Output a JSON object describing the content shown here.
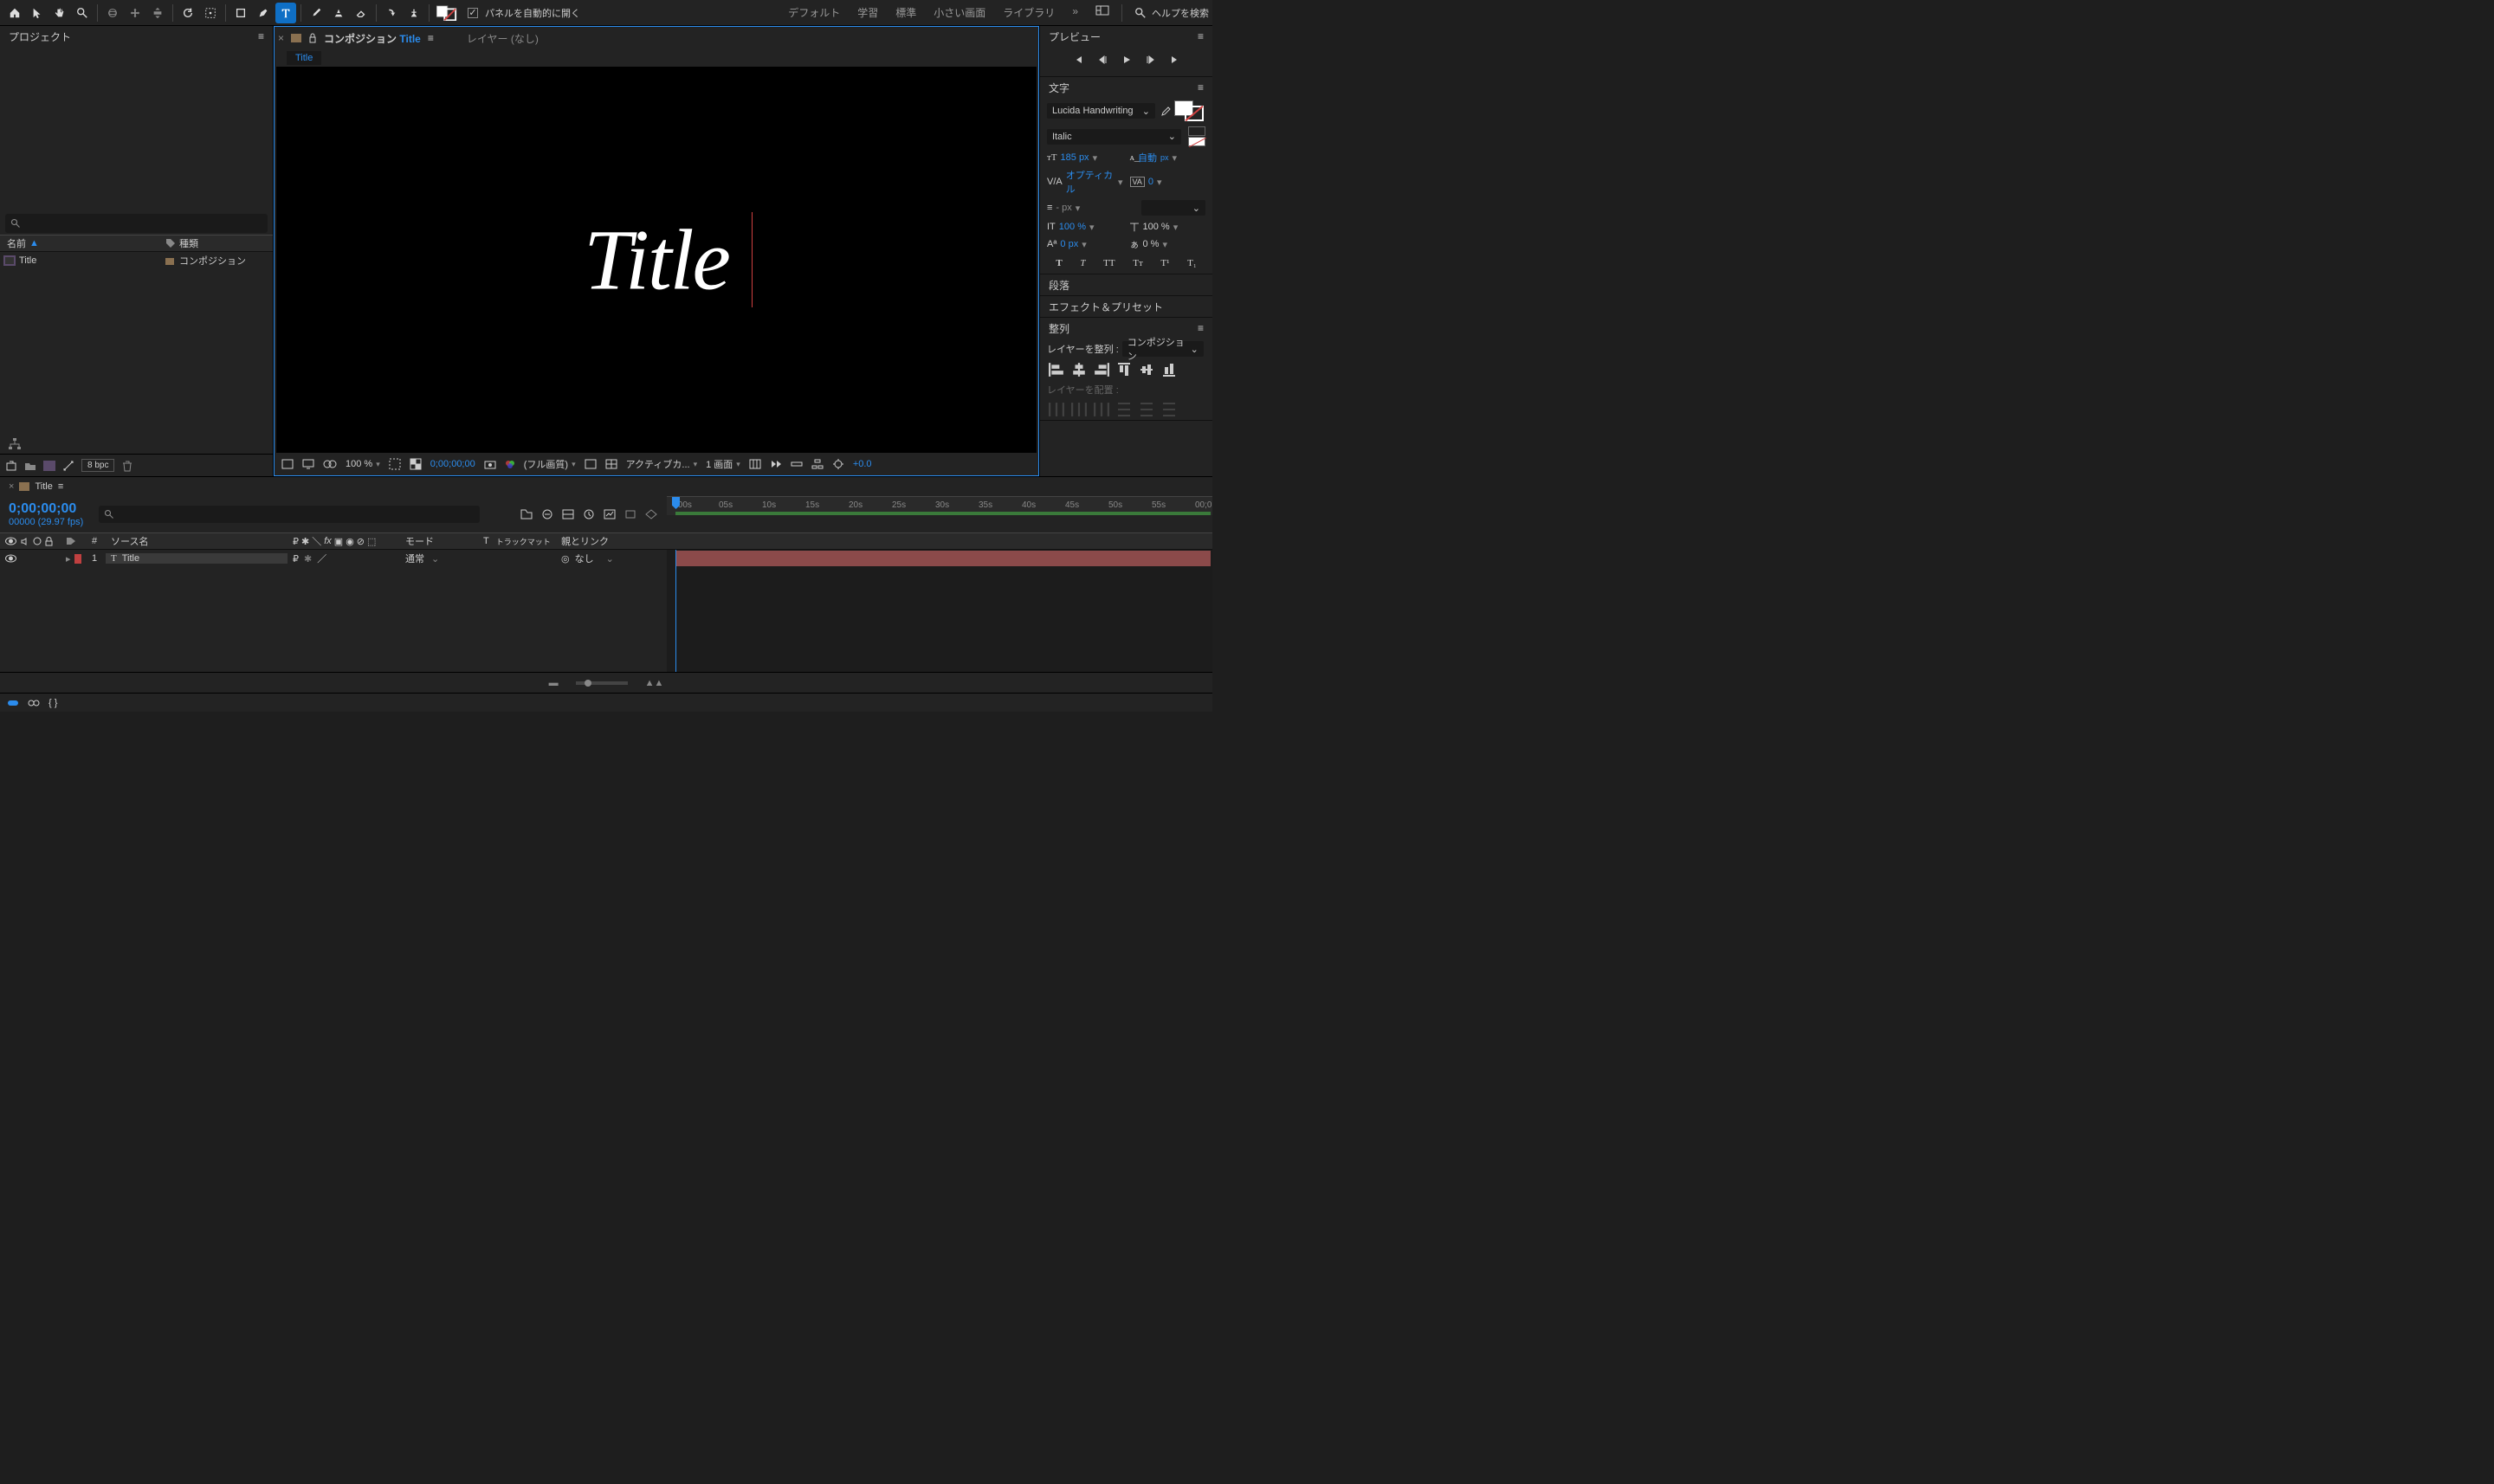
{
  "toolbar": {
    "auto_open": "パネルを自動的に開く",
    "workspaces": [
      "デフォルト",
      "学習",
      "標準",
      "小さい画面",
      "ライブラリ"
    ],
    "search_help": "ヘルプを検索"
  },
  "project": {
    "title": "プロジェクト",
    "col_name": "名前",
    "col_type": "種類",
    "item_name": "Title",
    "item_type": "コンポジション",
    "bpc": "8 bpc"
  },
  "composition": {
    "tab_label": "コンポジション",
    "tab_name": "Title",
    "layer_tab": "レイヤー (なし)",
    "sub_tab": "Title",
    "canvas_text": "Title"
  },
  "viewer_footer": {
    "zoom": "100 %",
    "time": "0;00;00;00",
    "quality": "(フル画質)",
    "camera": "アクティブカ...",
    "views": "1 画面",
    "exposure": "+0.0"
  },
  "preview": {
    "title": "プレビュー"
  },
  "character": {
    "title": "文字",
    "font": "Lucida Handwriting",
    "style": "Italic",
    "size": "185 px",
    "leading": "自動",
    "leading_unit": "px",
    "kerning": "オプティカル",
    "tracking": "0",
    "stroke_unit": "- px",
    "vscale": "100 %",
    "hscale": "100 %",
    "baseline": "0 px",
    "tsume": "0 %",
    "t_buttons": [
      "T",
      "T",
      "TT",
      "Tᴛ",
      "T¹",
      "T₁"
    ]
  },
  "paragraph": {
    "title": "段落"
  },
  "effects": {
    "title": "エフェクト＆プリセット"
  },
  "align": {
    "title": "整列",
    "align_label": "レイヤーを整列 :",
    "align_to": "コンポジション",
    "distribute_label": "レイヤーを配置 :"
  },
  "timeline": {
    "tab": "Title",
    "timecode": "0;00;00;00",
    "frame_info": "00000 (29.97 fps)",
    "col_num": "#",
    "col_source": "ソース名",
    "col_mode": "モード",
    "col_trkmat_t": "T",
    "col_trkmat": "トラックマット",
    "col_parent": "親とリンク",
    "layer_num": "1",
    "layer_name": "Title",
    "layer_mode": "通常",
    "layer_parent": "なし",
    "ruler_marks": [
      ":00s",
      "05s",
      "10s",
      "15s",
      "20s",
      "25s",
      "30s",
      "35s",
      "40s",
      "45s",
      "50s",
      "55s",
      "00;0"
    ]
  }
}
